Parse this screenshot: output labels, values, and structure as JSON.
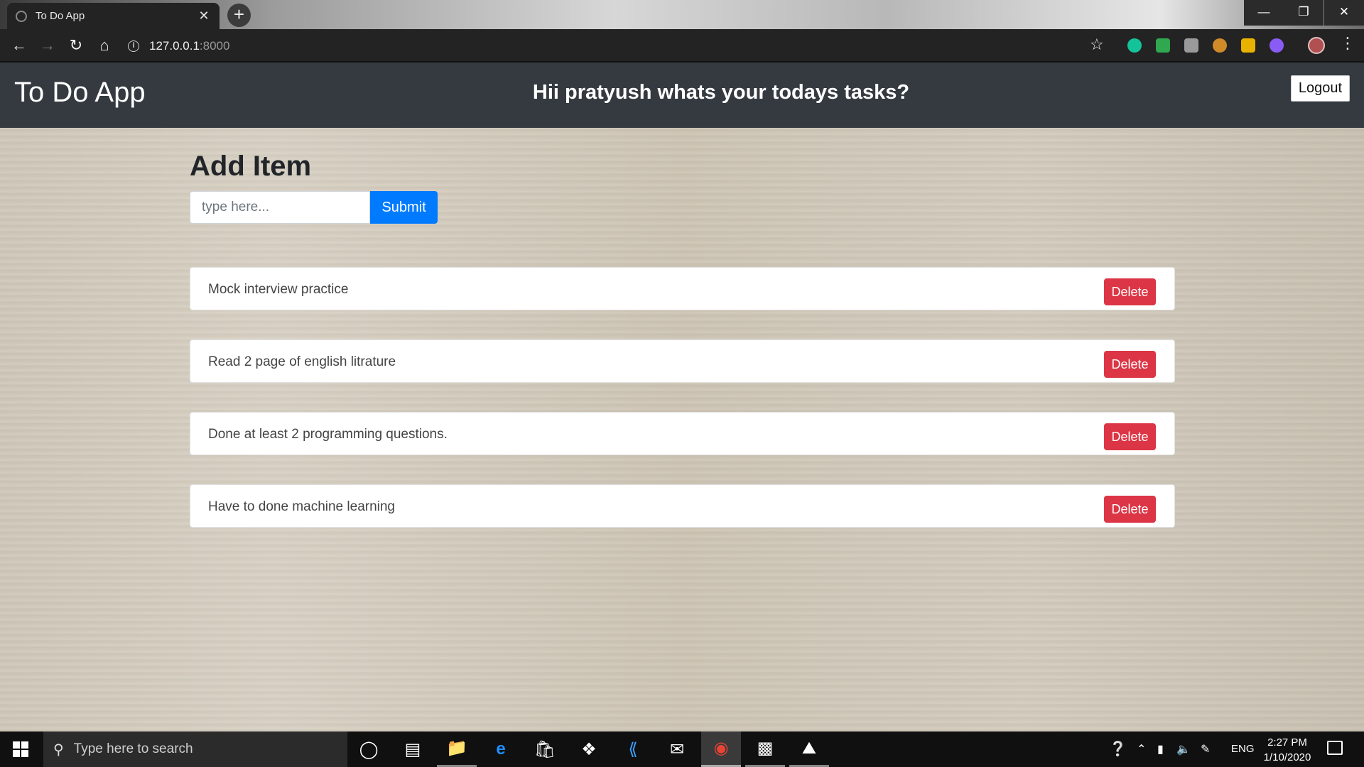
{
  "browser": {
    "tab_title": "To Do App",
    "new_tab": "+",
    "close_tab": "✕",
    "url_host": "127.0.0.1",
    "url_port": ":8000"
  },
  "app": {
    "brand": "To Do App",
    "greeting": "Hii pratyush whats your todays tasks?",
    "logout_label": "Logout",
    "add_title": "Add Item",
    "input_placeholder": "type here...",
    "submit_label": "Submit",
    "delete_label": "Delete",
    "tasks": [
      "Mock interview practice",
      "Read 2 page of english litrature",
      "Done at least 2 programming questions.",
      "Have to done machine learning"
    ]
  },
  "taskbar": {
    "search_placeholder": "Type here to search",
    "language": "ENG",
    "time": "2:27 PM",
    "date": "1/10/2020"
  },
  "colors": {
    "navbar": "#343a40",
    "primary": "#007bff",
    "danger": "#dc3545"
  }
}
